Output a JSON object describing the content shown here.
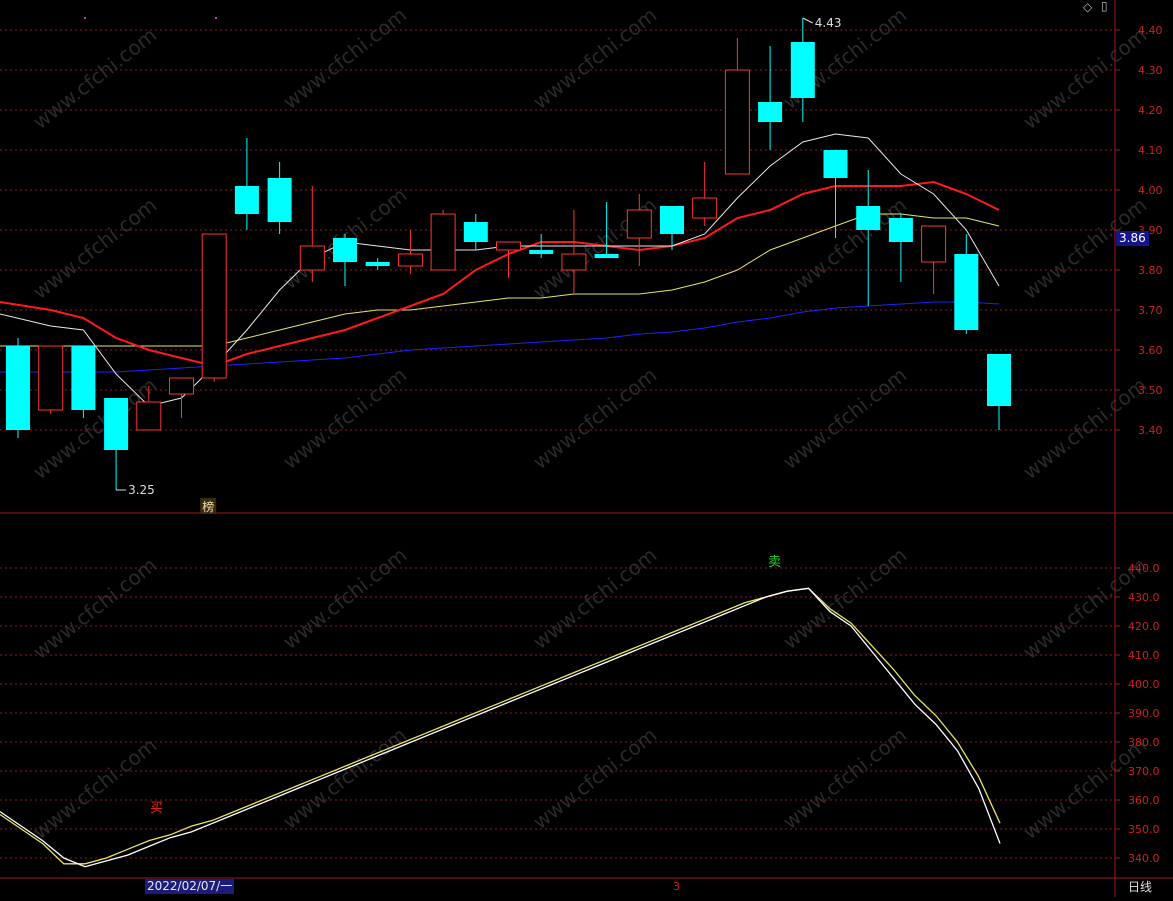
{
  "toolbar": {
    "icons": [
      "diamond-icon",
      "window-icon"
    ]
  },
  "chart_data": [
    {
      "type": "candlestick",
      "panel": "price",
      "ylim": [
        3.2,
        4.45
      ],
      "yticks": [
        "4.40",
        "4.30",
        "4.20",
        "4.10",
        "4.00",
        "3.90",
        "3.80",
        "3.70",
        "3.60",
        "3.50",
        "3.40"
      ],
      "current_price_label": "3.86",
      "high_marker": {
        "label": "4.43",
        "index": 24,
        "value": 4.43
      },
      "low_marker": {
        "label": "3.25",
        "index": 3,
        "value": 3.25
      },
      "event_badge": {
        "label": "榜",
        "index": 6
      },
      "colors": {
        "up": "#ff3333",
        "down": "#00ffff",
        "ma_white": "#e8e8e8",
        "ma_red": "#ff1a1a",
        "ma_yellow": "#e5e566",
        "ma_blue": "#2020ff",
        "grid": "#8a1a1a",
        "axis_text": "#cc2020"
      },
      "candles": [
        {
          "o": 3.61,
          "h": 3.63,
          "l": 3.38,
          "c": 3.4
        },
        {
          "o": 3.45,
          "h": 3.61,
          "l": 3.44,
          "c": 3.61
        },
        {
          "o": 3.61,
          "h": 3.61,
          "l": 3.43,
          "c": 3.45
        },
        {
          "o": 3.48,
          "h": 3.48,
          "l": 3.25,
          "c": 3.35
        },
        {
          "o": 3.4,
          "h": 3.51,
          "l": 3.4,
          "c": 3.47
        },
        {
          "o": 3.49,
          "h": 3.53,
          "l": 3.43,
          "c": 3.53
        },
        {
          "o": 3.53,
          "h": 3.89,
          "l": 3.52,
          "c": 3.89
        },
        {
          "o": 4.01,
          "h": 4.13,
          "l": 3.9,
          "c": 3.94
        },
        {
          "o": 4.03,
          "h": 4.07,
          "l": 3.89,
          "c": 3.92
        },
        {
          "o": 3.8,
          "h": 4.01,
          "l": 3.77,
          "c": 3.86
        },
        {
          "o": 3.88,
          "h": 3.89,
          "l": 3.76,
          "c": 3.82
        },
        {
          "o": 3.82,
          "h": 3.83,
          "l": 3.8,
          "c": 3.81
        },
        {
          "o": 3.81,
          "h": 3.9,
          "l": 3.79,
          "c": 3.84
        },
        {
          "o": 3.8,
          "h": 3.95,
          "l": 3.8,
          "c": 3.94
        },
        {
          "o": 3.92,
          "h": 3.94,
          "l": 3.85,
          "c": 3.87
        },
        {
          "o": 3.85,
          "h": 3.87,
          "l": 3.78,
          "c": 3.87
        },
        {
          "o": 3.85,
          "h": 3.89,
          "l": 3.83,
          "c": 3.84
        },
        {
          "o": 3.8,
          "h": 3.95,
          "l": 3.74,
          "c": 3.84
        },
        {
          "o": 3.84,
          "h": 3.97,
          "l": 3.83,
          "c": 3.83
        },
        {
          "o": 3.88,
          "h": 3.99,
          "l": 3.81,
          "c": 3.95
        },
        {
          "o": 3.96,
          "h": 3.96,
          "l": 3.85,
          "c": 3.89
        },
        {
          "o": 3.93,
          "h": 4.07,
          "l": 3.91,
          "c": 3.98
        },
        {
          "o": 4.04,
          "h": 4.38,
          "l": 4.04,
          "c": 4.3
        },
        {
          "o": 4.22,
          "h": 4.36,
          "l": 4.1,
          "c": 4.17
        },
        {
          "o": 4.37,
          "h": 4.43,
          "l": 4.17,
          "c": 4.23
        },
        {
          "o": 4.1,
          "h": 4.1,
          "l": 3.88,
          "c": 4.03
        },
        {
          "o": 3.96,
          "h": 4.05,
          "l": 3.71,
          "c": 3.9
        },
        {
          "o": 3.93,
          "h": 3.94,
          "l": 3.77,
          "c": 3.87
        },
        {
          "o": 3.82,
          "h": 3.91,
          "l": 3.74,
          "c": 3.91
        },
        {
          "o": 3.84,
          "h": 3.89,
          "l": 3.64,
          "c": 3.65
        },
        {
          "o": 3.59,
          "h": 3.59,
          "l": 3.4,
          "c": 3.46
        }
      ],
      "ma_white": [
        3.69,
        3.66,
        3.65,
        3.54,
        3.46,
        3.48,
        3.56,
        3.65,
        3.75,
        3.83,
        3.87,
        3.86,
        3.85,
        3.85,
        3.85,
        3.86,
        3.86,
        3.86,
        3.86,
        3.86,
        3.86,
        3.89,
        3.98,
        4.06,
        4.12,
        4.14,
        4.13,
        4.04,
        3.99,
        3.9,
        3.76
      ],
      "ma_red": [
        3.72,
        3.7,
        3.68,
        3.63,
        3.6,
        3.58,
        3.56,
        3.59,
        3.61,
        3.63,
        3.65,
        3.68,
        3.71,
        3.74,
        3.8,
        3.84,
        3.87,
        3.87,
        3.86,
        3.85,
        3.86,
        3.88,
        3.93,
        3.95,
        3.99,
        4.01,
        4.01,
        4.01,
        4.02,
        3.99,
        3.95
      ],
      "ma_yellow": [
        3.61,
        3.61,
        3.61,
        3.61,
        3.61,
        3.61,
        3.61,
        3.63,
        3.65,
        3.67,
        3.69,
        3.7,
        3.7,
        3.71,
        3.72,
        3.73,
        3.73,
        3.74,
        3.74,
        3.74,
        3.75,
        3.77,
        3.8,
        3.85,
        3.88,
        3.91,
        3.94,
        3.94,
        3.93,
        3.93,
        3.91
      ],
      "ma_blue": [
        3.545,
        3.545,
        3.545,
        3.545,
        3.55,
        3.555,
        3.56,
        3.565,
        3.57,
        3.575,
        3.58,
        3.59,
        3.6,
        3.605,
        3.61,
        3.615,
        3.62,
        3.625,
        3.63,
        3.64,
        3.645,
        3.655,
        3.67,
        3.68,
        3.695,
        3.705,
        3.71,
        3.715,
        3.72,
        3.72,
        3.715
      ]
    },
    {
      "type": "line",
      "panel": "indicator",
      "ylim": [
        333,
        452
      ],
      "yticks": [
        "440.0",
        "430.0",
        "420.0",
        "410.0",
        "400.0",
        "390.0",
        "380.0",
        "370.0",
        "360.0",
        "350.0",
        "340.0"
      ],
      "buy_label": "买",
      "sell_label": "卖",
      "buy_index": 3,
      "sell_index": 23,
      "series": [
        {
          "values": [
            356,
            351,
            346,
            340,
            337,
            339,
            341,
            344,
            347,
            349,
            352,
            355,
            358,
            361,
            364,
            367,
            370,
            373,
            376,
            379,
            382,
            385,
            388,
            391,
            394,
            397,
            400,
            403,
            406,
            409,
            412,
            415,
            418,
            421,
            424,
            427,
            430,
            432,
            433,
            425,
            420,
            411,
            402,
            393,
            386,
            377,
            364,
            345
          ]
        },
        {
          "values": [
            355,
            350,
            345,
            338,
            338,
            340,
            343,
            346,
            348,
            351,
            353,
            356,
            359,
            362,
            365,
            368,
            371,
            374,
            377,
            380,
            383,
            386,
            389,
            392,
            395,
            398,
            401,
            404,
            407,
            410,
            413,
            416,
            419,
            422,
            425,
            428,
            430,
            432,
            433,
            426,
            421,
            413,
            405,
            396,
            389,
            380,
            368,
            352
          ]
        }
      ]
    }
  ],
  "date_label": "2022/02/07/一",
  "bottom_marker": "3",
  "period_label": "日线",
  "watermark": "www.cfchi.com"
}
